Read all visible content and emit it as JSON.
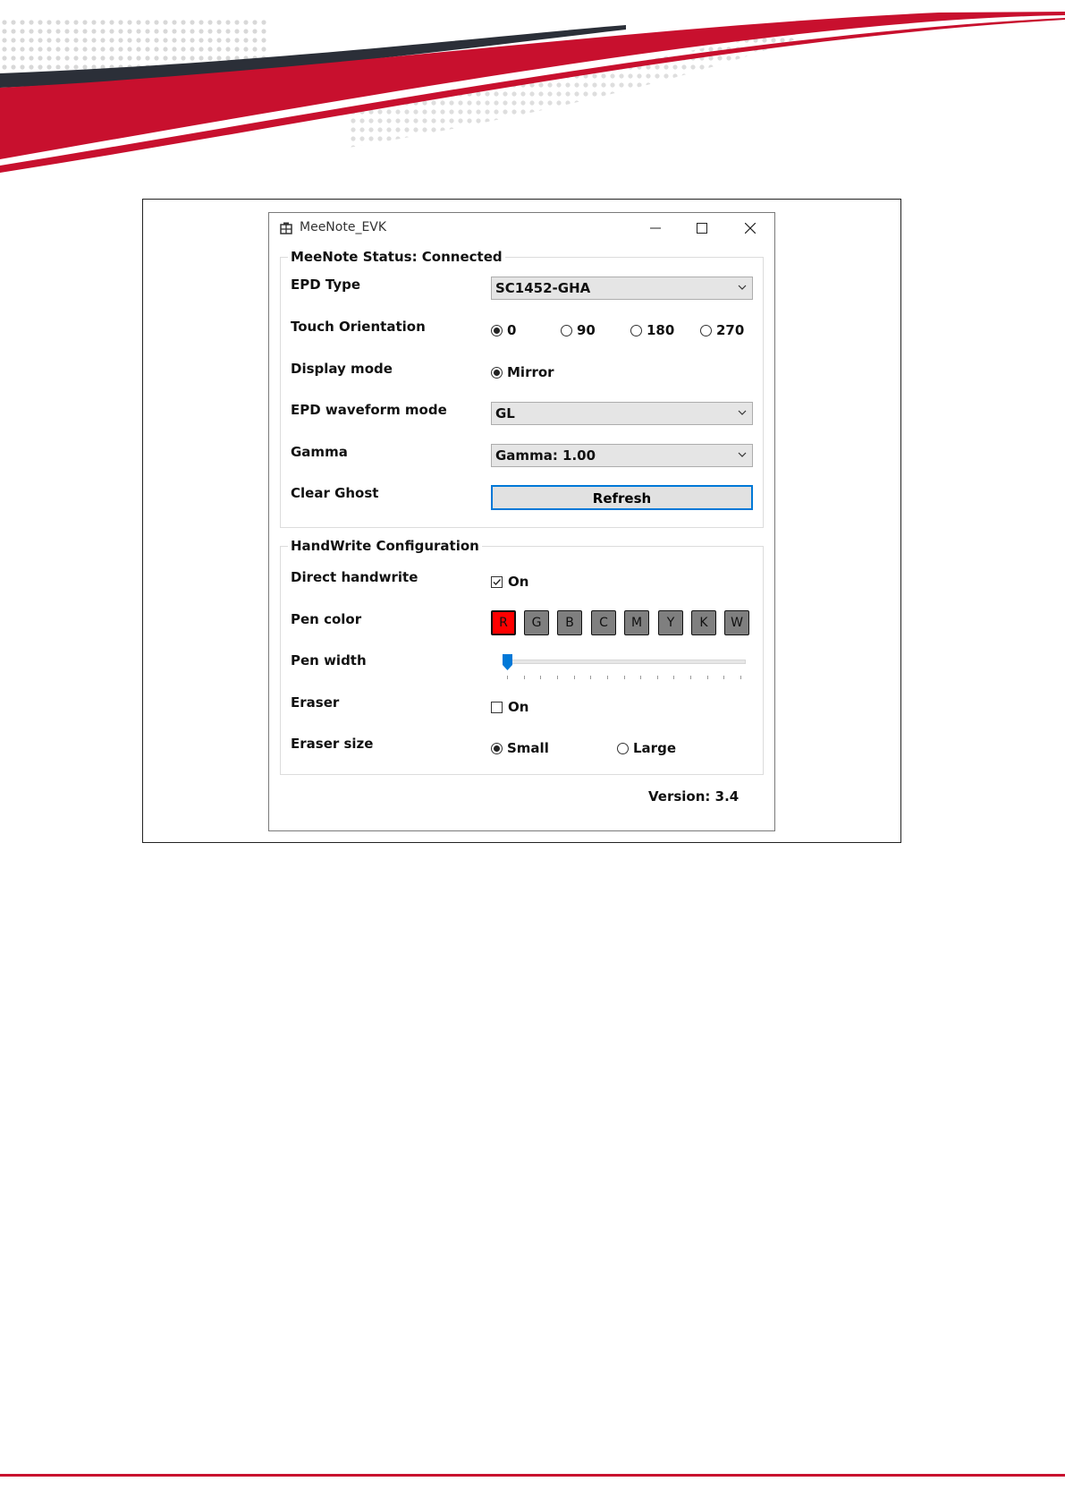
{
  "window": {
    "title": "MeeNote_EVK",
    "app_icon": "app-grid-icon",
    "controls": [
      "minimize-icon",
      "maximize-icon",
      "close-icon"
    ]
  },
  "status_group": {
    "legend": "MeeNote Status: Connected",
    "epd_type": {
      "label": "EPD Type",
      "value": "SC1452-GHA"
    },
    "touch_orientation": {
      "label": "Touch Orientation",
      "options": [
        "0",
        "90",
        "180",
        "270"
      ],
      "selected": "0"
    },
    "display_mode": {
      "label": "Display mode",
      "option": "Mirror",
      "selected": true
    },
    "waveform_mode": {
      "label": "EPD waveform mode",
      "value": "GL"
    },
    "gamma": {
      "label": "Gamma",
      "value": "Gamma: 1.00"
    },
    "clear_ghost": {
      "label": "Clear Ghost",
      "button": "Refresh"
    }
  },
  "handwrite_group": {
    "legend": "HandWrite Configuration",
    "direct_handwrite": {
      "label": "Direct handwrite",
      "option": "On",
      "checked": true
    },
    "pen_color": {
      "label": "Pen color",
      "options": [
        "R",
        "G",
        "B",
        "C",
        "M",
        "Y",
        "K",
        "W"
      ],
      "selected": "R",
      "selected_color": "#ff0000"
    },
    "pen_width": {
      "label": "Pen width",
      "level": 0
    },
    "eraser": {
      "label": "Eraser",
      "option": "On",
      "checked": false
    },
    "eraser_size": {
      "label": "Eraser size",
      "options": [
        "Small",
        "Large"
      ],
      "selected": "Small"
    }
  },
  "version": "Version: 3.4",
  "theme": {
    "brand_red": "#c8102e",
    "dark_stripe": "#2b2f38",
    "accent_blue": "#0078d7"
  }
}
